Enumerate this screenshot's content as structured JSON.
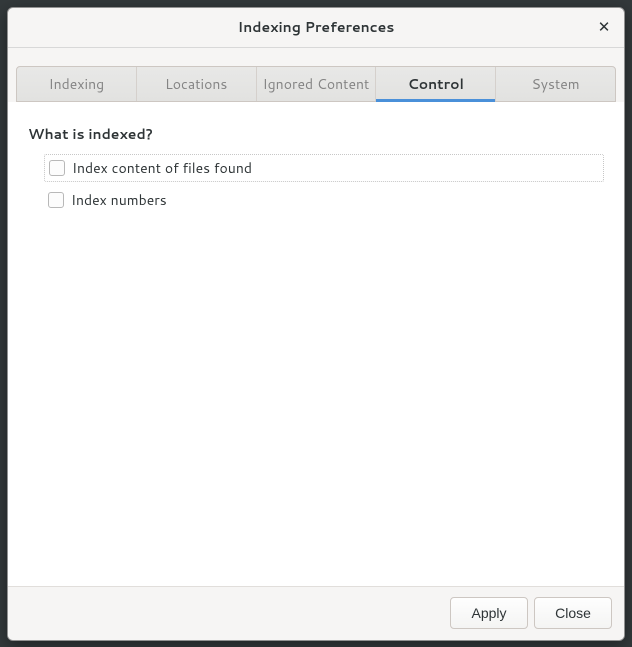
{
  "titlebar": {
    "title": "Indexing Preferences"
  },
  "tabs": {
    "items": [
      {
        "label": "Indexing",
        "active": false
      },
      {
        "label": "Locations",
        "active": false
      },
      {
        "label": "Ignored Content",
        "active": false
      },
      {
        "label": "Control",
        "active": true
      },
      {
        "label": "System",
        "active": false
      }
    ]
  },
  "section": {
    "heading": "What is indexed?"
  },
  "options": [
    {
      "label": "Index content of files found",
      "checked": false,
      "framed": true
    },
    {
      "label": "Index numbers",
      "checked": false,
      "framed": false
    }
  ],
  "buttons": {
    "apply": "Apply",
    "close": "Close"
  }
}
